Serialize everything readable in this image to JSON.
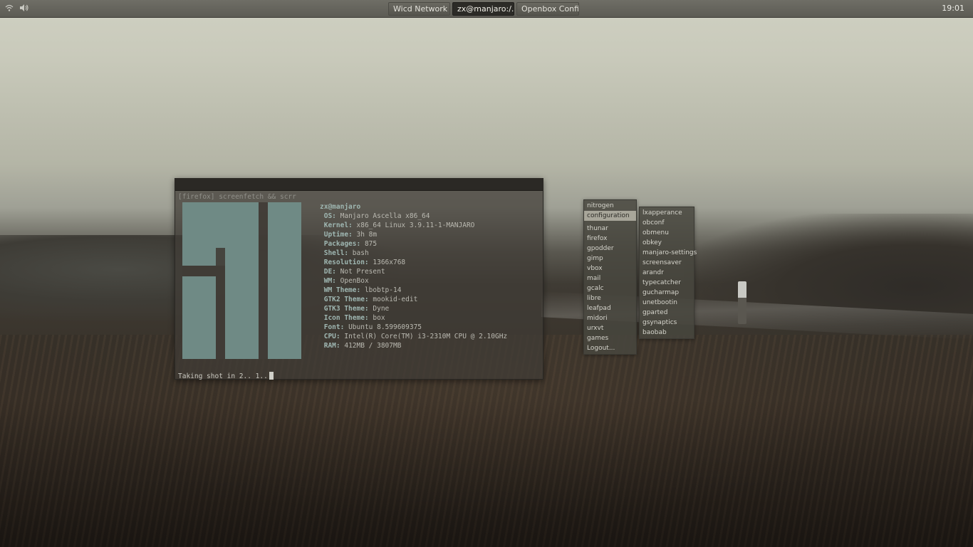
{
  "panel": {
    "tray_icons": [
      "wifi-icon",
      "speaker-icon"
    ],
    "tasks": [
      {
        "label": "Wicd Network ...",
        "active": false
      },
      {
        "label": "zx@manjaro:/...",
        "active": true
      },
      {
        "label": "Openbox Confi...",
        "active": false
      }
    ],
    "clock": "19:01"
  },
  "terminal": {
    "prompt": "[firefox] screenfetch && scrr",
    "user": "zx@manjaro",
    "info": [
      {
        "key": "OS:",
        "value": "Manjaro Ascella x86_64"
      },
      {
        "key": "Kernel:",
        "value": "x86_64 Linux 3.9.11-1-MANJARO"
      },
      {
        "key": "Uptime:",
        "value": "3h 8m"
      },
      {
        "key": "Packages:",
        "value": "875"
      },
      {
        "key": "Shell:",
        "value": "bash"
      },
      {
        "key": "Resolution:",
        "value": "1366x768"
      },
      {
        "key": "DE:",
        "value": "Not Present"
      },
      {
        "key": "WM:",
        "value": "OpenBox"
      },
      {
        "key": "WM Theme:",
        "value": "lbobtp-14"
      },
      {
        "key": "GTK2 Theme:",
        "value": "mookid-edit"
      },
      {
        "key": "GTK3 Theme:",
        "value": "Dyne"
      },
      {
        "key": "Icon Theme:",
        "value": "box"
      },
      {
        "key": "Font:",
        "value": "Ubuntu 8.599609375"
      },
      {
        "key": "CPU:",
        "value": "Intel(R) Core(TM) i3-2310M CPU @ 2.10GHz"
      },
      {
        "key": "RAM:",
        "value": "412MB / 3807MB"
      }
    ],
    "status": "Taking shot in 2.. 1.."
  },
  "menu_main": {
    "items_top": [
      "nitrogen",
      "configuration"
    ],
    "selected": "configuration",
    "items": [
      "thunar",
      "firefox",
      "gpodder",
      "gimp",
      "vbox",
      "mail",
      "gcalc",
      "libre",
      "leafpad",
      "midori",
      "urxvt",
      "games",
      "Logout..."
    ]
  },
  "menu_sub": {
    "items": [
      "lxapperance",
      "obconf",
      "obmenu",
      "obkey",
      "manjaro-settings",
      "screensaver",
      "arandr",
      "typecatcher",
      "gucharmap",
      "unetbootin",
      "gparted",
      "gsynaptics",
      "baobab"
    ]
  },
  "colors": {
    "logo": "#6f8a85",
    "panel": "#5c5b54",
    "terminal_key": "#9fb7b2"
  }
}
